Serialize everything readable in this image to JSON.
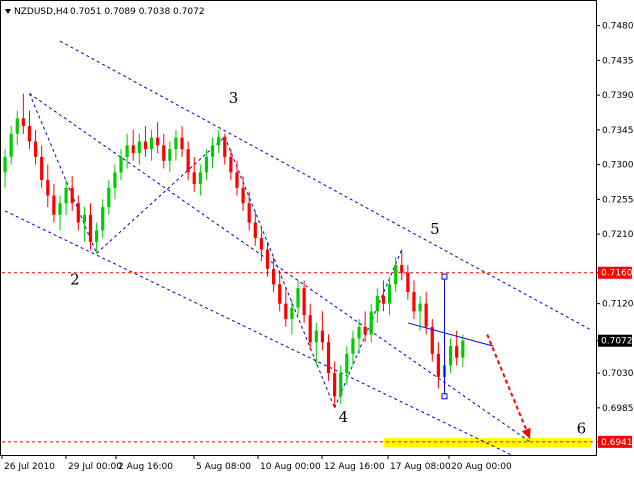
{
  "header": {
    "symbol": "NZDUSD,H4",
    "ohlc": "0.7051 0.7089 0.7038 0.7072"
  },
  "chart_data": {
    "type": "candlestick",
    "title": "NZDUSD,H4",
    "ylim": [
      0.6924,
      0.7508
    ],
    "y_ticks": [
      "0.7480",
      "0.7435",
      "0.7390",
      "0.7345",
      "0.7300",
      "0.7255",
      "0.7210",
      "0.7160",
      "0.7120",
      "0.7072",
      "0.7030",
      "0.6985",
      "0.6941"
    ],
    "x_ticks": [
      "26 Jul 2010",
      "29 Jul 00:00",
      "2 Aug 16:00",
      "5 Aug 08:00",
      "10 Aug 00:00",
      "12 Aug 16:00",
      "17 Aug 08:00",
      "20 Aug 00:00"
    ],
    "price_tags": [
      {
        "label": "0.7160",
        "value": 0.716,
        "color": "#ff0000"
      },
      {
        "label": "0.7072",
        "value": 0.7072,
        "color": "#000000"
      },
      {
        "label": "0.6941",
        "value": 0.6941,
        "color": "#ff0000"
      }
    ],
    "wave_labels": [
      {
        "label": "2",
        "bar": 10,
        "value": 0.7145
      },
      {
        "label": "3",
        "bar": 36,
        "value": 0.738
      },
      {
        "label": "4",
        "bar": 54,
        "value": 0.6967
      },
      {
        "label": "5",
        "bar": 69,
        "value": 0.721
      },
      {
        "label": "6",
        "bar": 93,
        "value": 0.6952
      }
    ],
    "target_zone": {
      "bar_start": 62,
      "bar_end": 96,
      "value_top": 0.6946,
      "value_bottom": 0.6934,
      "color": "#ffff00"
    },
    "channel_lines": [
      {
        "from": {
          "bar": 9,
          "value": 0.746
        },
        "to": {
          "bar": 96,
          "value": 0.7086
        }
      },
      {
        "from": {
          "bar": 4,
          "value": 0.7392
        },
        "to": {
          "bar": 86,
          "value": 0.6941
        }
      },
      {
        "from": {
          "bar": 0,
          "value": 0.724
        },
        "to": {
          "bar": 83,
          "value": 0.6924
        }
      }
    ],
    "pattern_lines": [
      {
        "from": {
          "bar": 4,
          "value": 0.7392
        },
        "to": {
          "bar": 15,
          "value": 0.7185
        }
      },
      {
        "from": {
          "bar": 15,
          "value": 0.7185
        },
        "to": {
          "bar": 36,
          "value": 0.7336
        }
      },
      {
        "from": {
          "bar": 36,
          "value": 0.7336
        },
        "to": {
          "bar": 54,
          "value": 0.6985
        }
      },
      {
        "from": {
          "bar": 54,
          "value": 0.6985
        },
        "to": {
          "bar": 65,
          "value": 0.719
        }
      }
    ],
    "support_resistance": [
      {
        "value": 0.716,
        "color": "#ff0000"
      },
      {
        "value": 0.6941,
        "color": "#ff0000"
      }
    ],
    "projection_arrow": {
      "from": {
        "bar": 79,
        "value": 0.708
      },
      "to": {
        "bar": 86,
        "value": 0.6945
      },
      "color": "#ff0000"
    },
    "marker_line": {
      "bar": 72,
      "top": 0.7155,
      "bottom": 0.7,
      "color": "#0000ff"
    },
    "horizontal_segment": {
      "from": {
        "bar": 66,
        "value": 0.7095
      },
      "to": {
        "bar": 80,
        "value": 0.7065
      },
      "color": "#0000ff"
    },
    "series": [
      {
        "name": "",
        "values": [
          [
            0.729,
            0.732,
            0.727,
            0.731
          ],
          [
            0.731,
            0.735,
            0.73,
            0.734
          ],
          [
            0.734,
            0.737,
            0.7325,
            0.736
          ],
          [
            0.736,
            0.7392,
            0.734,
            0.735
          ],
          [
            0.735,
            0.737,
            0.732,
            0.733
          ],
          [
            0.733,
            0.7345,
            0.73,
            0.731
          ],
          [
            0.731,
            0.7325,
            0.727,
            0.728
          ],
          [
            0.728,
            0.73,
            0.7245,
            0.726
          ],
          [
            0.726,
            0.7275,
            0.7225,
            0.7235
          ],
          [
            0.7235,
            0.726,
            0.7215,
            0.725
          ],
          [
            0.725,
            0.728,
            0.7235,
            0.727
          ],
          [
            0.727,
            0.7285,
            0.724,
            0.725
          ],
          [
            0.725,
            0.726,
            0.7215,
            0.7225
          ],
          [
            0.7225,
            0.7245,
            0.72,
            0.7235
          ],
          [
            0.7235,
            0.725,
            0.719,
            0.72
          ],
          [
            0.72,
            0.7225,
            0.7185,
            0.7215
          ],
          [
            0.7215,
            0.7255,
            0.7205,
            0.7245
          ],
          [
            0.7245,
            0.728,
            0.7235,
            0.727
          ],
          [
            0.727,
            0.73,
            0.7255,
            0.729
          ],
          [
            0.729,
            0.732,
            0.728,
            0.731
          ],
          [
            0.731,
            0.734,
            0.7295,
            0.7325
          ],
          [
            0.7325,
            0.7345,
            0.7305,
            0.7315
          ],
          [
            0.7315,
            0.734,
            0.73,
            0.733
          ],
          [
            0.733,
            0.735,
            0.731,
            0.732
          ],
          [
            0.732,
            0.7345,
            0.7305,
            0.7335
          ],
          [
            0.7335,
            0.7355,
            0.7315,
            0.7325
          ],
          [
            0.7325,
            0.734,
            0.7295,
            0.7305
          ],
          [
            0.7305,
            0.733,
            0.729,
            0.732
          ],
          [
            0.732,
            0.7345,
            0.7305,
            0.7335
          ],
          [
            0.7335,
            0.735,
            0.731,
            0.732
          ],
          [
            0.732,
            0.733,
            0.728,
            0.729
          ],
          [
            0.729,
            0.731,
            0.7265,
            0.7275
          ],
          [
            0.7275,
            0.73,
            0.726,
            0.729
          ],
          [
            0.729,
            0.732,
            0.728,
            0.731
          ],
          [
            0.731,
            0.7335,
            0.7295,
            0.7325
          ],
          [
            0.7325,
            0.7345,
            0.7315,
            0.7336
          ],
          [
            0.7336,
            0.734,
            0.73,
            0.731
          ],
          [
            0.731,
            0.732,
            0.728,
            0.729
          ],
          [
            0.729,
            0.7305,
            0.726,
            0.727
          ],
          [
            0.727,
            0.7285,
            0.724,
            0.725
          ],
          [
            0.725,
            0.7265,
            0.7215,
            0.7225
          ],
          [
            0.7225,
            0.724,
            0.7195,
            0.7205
          ],
          [
            0.7205,
            0.722,
            0.7175,
            0.719
          ],
          [
            0.719,
            0.72,
            0.7155,
            0.7165
          ],
          [
            0.7165,
            0.718,
            0.7135,
            0.7145
          ],
          [
            0.7145,
            0.716,
            0.711,
            0.712
          ],
          [
            0.712,
            0.714,
            0.709,
            0.71
          ],
          [
            0.71,
            0.7125,
            0.708,
            0.7115
          ],
          [
            0.7115,
            0.715,
            0.7105,
            0.714
          ],
          [
            0.714,
            0.715,
            0.7095,
            0.7105
          ],
          [
            0.7105,
            0.712,
            0.706,
            0.707
          ],
          [
            0.707,
            0.7095,
            0.704,
            0.7085
          ],
          [
            0.7085,
            0.711,
            0.706,
            0.707
          ],
          [
            0.707,
            0.708,
            0.702,
            0.703
          ],
          [
            0.703,
            0.7045,
            0.6985,
            0.7
          ],
          [
            0.7,
            0.704,
            0.699,
            0.703
          ],
          [
            0.703,
            0.7065,
            0.7015,
            0.7055
          ],
          [
            0.7055,
            0.7085,
            0.704,
            0.7075
          ],
          [
            0.7075,
            0.71,
            0.7055,
            0.709
          ],
          [
            0.709,
            0.711,
            0.707,
            0.708
          ],
          [
            0.708,
            0.712,
            0.707,
            0.711
          ],
          [
            0.711,
            0.714,
            0.7095,
            0.713
          ],
          [
            0.713,
            0.715,
            0.711,
            0.712
          ],
          [
            0.712,
            0.7155,
            0.7105,
            0.7145
          ],
          [
            0.7145,
            0.718,
            0.7135,
            0.717
          ],
          [
            0.717,
            0.719,
            0.715,
            0.716
          ],
          [
            0.716,
            0.717,
            0.7125,
            0.7135
          ],
          [
            0.7135,
            0.715,
            0.71,
            0.711
          ],
          [
            0.711,
            0.713,
            0.7085,
            0.712
          ],
          [
            0.712,
            0.7135,
            0.708,
            0.709
          ],
          [
            0.709,
            0.71,
            0.7045,
            0.7055
          ],
          [
            0.7055,
            0.707,
            0.701,
            0.7025
          ],
          [
            0.7025,
            0.705,
            0.7,
            0.704
          ],
          [
            0.704,
            0.7075,
            0.703,
            0.7065
          ],
          [
            0.7065,
            0.7085,
            0.704,
            0.705
          ],
          [
            0.705,
            0.708,
            0.7038,
            0.7072
          ]
        ]
      }
    ]
  }
}
